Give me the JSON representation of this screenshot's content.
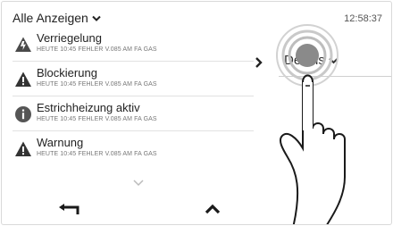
{
  "header": {
    "filter_label": "Alle Anzeigen",
    "clock": "12:58:37"
  },
  "messages": [
    {
      "title": "Verriegelung",
      "subtitle": "HEUTE 10:45 FEHLER V.085  AM FA GAS",
      "icon": "lock-warning-icon"
    },
    {
      "title": "Blockierung",
      "subtitle": "HEUTE 10:45 FEHLER V.085  AM FA GAS",
      "icon": "warning-triangle-icon"
    },
    {
      "title": "Estrichheizung aktiv",
      "subtitle": "HEUTE 10:45 FEHLER V.085  AM FA GAS",
      "icon": "info-circle-icon"
    },
    {
      "title": "Warnung",
      "subtitle": "HEUTE 10:45 FEHLER V.085  AM FA GAS",
      "icon": "warning-triangle-icon"
    }
  ],
  "details": {
    "label": "Details"
  },
  "colors": {
    "icon_gray": "#4a4a4a",
    "touch_ring": "#bdbdbd",
    "touch_center": "#8a8a8a"
  }
}
